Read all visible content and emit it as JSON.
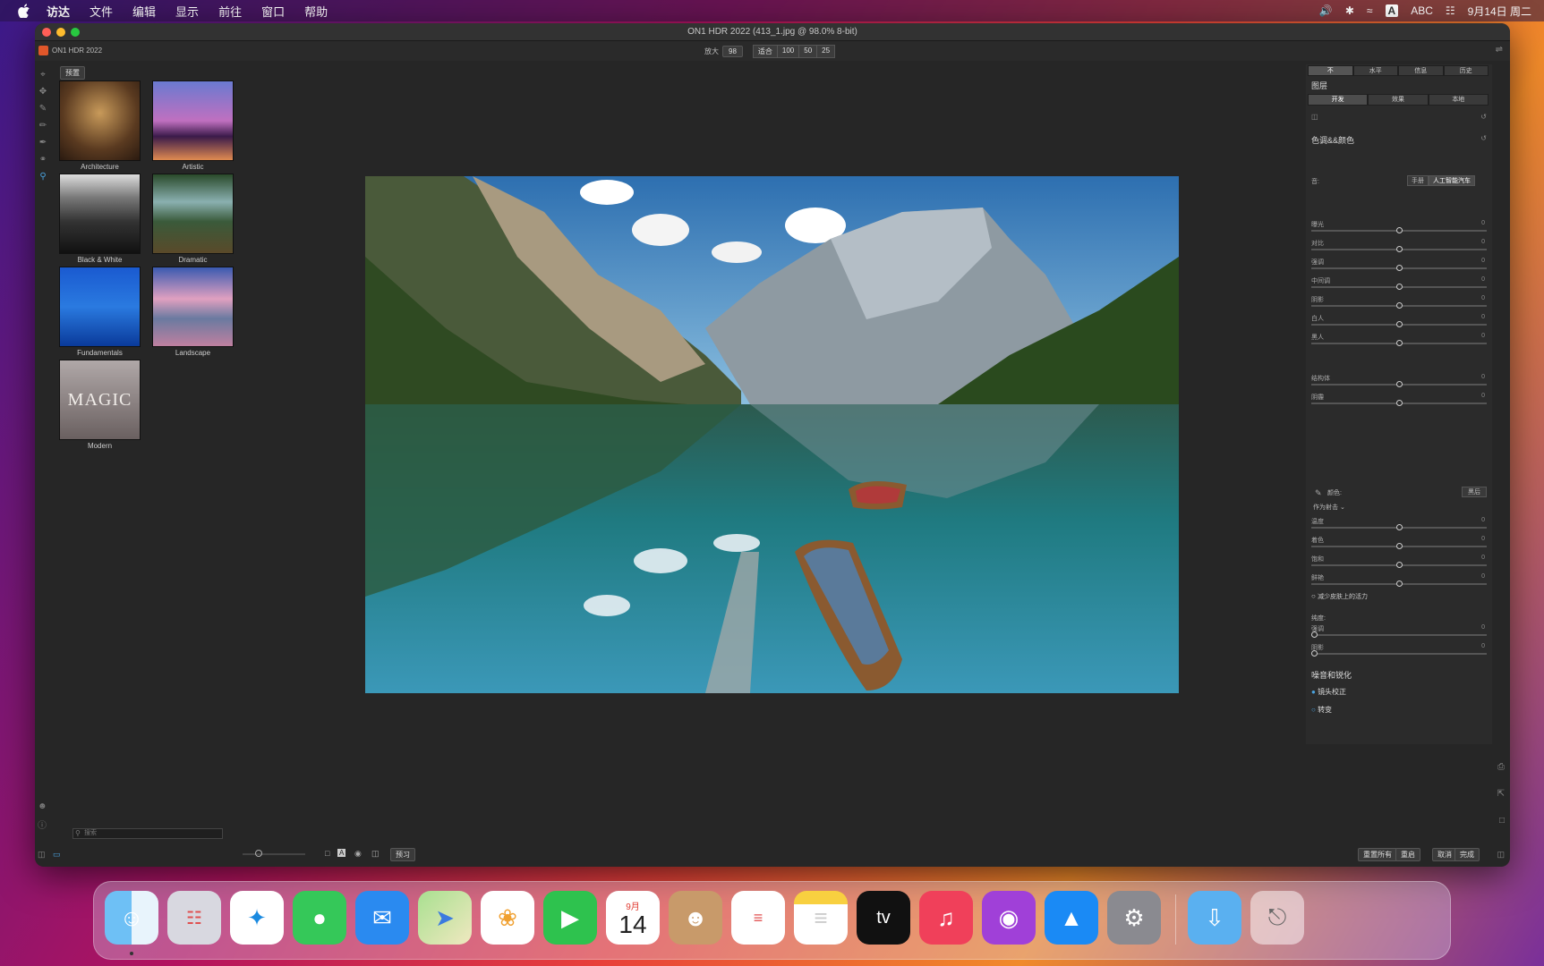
{
  "menubar": {
    "items": [
      "访达",
      "文件",
      "编辑",
      "显示",
      "前往",
      "窗口",
      "帮助"
    ],
    "input_label": "ABC",
    "datetime": "9月14日 周二"
  },
  "window": {
    "title": "ON1 HDR 2022 (413_1.jpg @ 98.0% 8-bit)",
    "app_name": "ON1 HDR 2022"
  },
  "zoom": {
    "label": "放大",
    "value": "98",
    "fit": "适合",
    "z100": "100",
    "z50": "50",
    "z25": "25"
  },
  "presets": {
    "button": "预置",
    "items": [
      "Architecture",
      "Artistic",
      "Black & White",
      "Dramatic",
      "Fundamentals",
      "Landscape",
      "Modern"
    ],
    "magic_text": "MAGIC",
    "search_placeholder": "搜索"
  },
  "right_panel": {
    "tabs": [
      "不",
      "水平",
      "信息",
      "历史"
    ],
    "layers_title": "图层",
    "subtabs": [
      "开发",
      "效果",
      "本地"
    ],
    "tone_title": "色调&&颜色",
    "tone_mode": "音:",
    "tone_buttons": [
      "手册",
      "人工智能汽车"
    ],
    "tone_sliders": [
      {
        "label": "曝光",
        "value": "0",
        "pos": 0.5
      },
      {
        "label": "对比",
        "value": "0",
        "pos": 0.5
      },
      {
        "label": "强调",
        "value": "0",
        "pos": 0.5
      },
      {
        "label": "中间调",
        "value": "0",
        "pos": 0.5
      },
      {
        "label": "阴影",
        "value": "0",
        "pos": 0.5
      },
      {
        "label": "白人",
        "value": "0",
        "pos": 0.5
      },
      {
        "label": "黑人",
        "value": "0",
        "pos": 0.5
      }
    ],
    "detail_sliders": [
      {
        "label": "结构体",
        "value": "0",
        "pos": 0.5
      },
      {
        "label": "阴霾",
        "value": "0",
        "pos": 0.5
      }
    ],
    "color_label": "颜色:",
    "color_after": "黑后",
    "color_mode": "作为射击 ⌄",
    "color_sliders": [
      {
        "label": "温度",
        "value": "0",
        "pos": 0.5
      },
      {
        "label": "着色",
        "value": "0",
        "pos": 0.5
      },
      {
        "label": "饱和",
        "value": "0",
        "pos": 0.5
      },
      {
        "label": "鲜艳",
        "value": "0",
        "pos": 0.5
      }
    ],
    "skin_option": "减少皮肤上的活力",
    "purity_label": "纯度:",
    "purity_sliders": [
      {
        "label": "强调",
        "value": "0",
        "pos": 0
      },
      {
        "label": "阴影",
        "value": "0",
        "pos": 0
      }
    ],
    "sections": [
      "噪音和锐化",
      "镜头校正",
      "转变"
    ]
  },
  "bottombar": {
    "preview": "预习",
    "reset_all": "重置所有",
    "reset": "重启",
    "cancel": "取消",
    "done": "完成"
  },
  "dock": {
    "calendar_month": "9月",
    "calendar_day": "14",
    "tv_label": "tv"
  }
}
